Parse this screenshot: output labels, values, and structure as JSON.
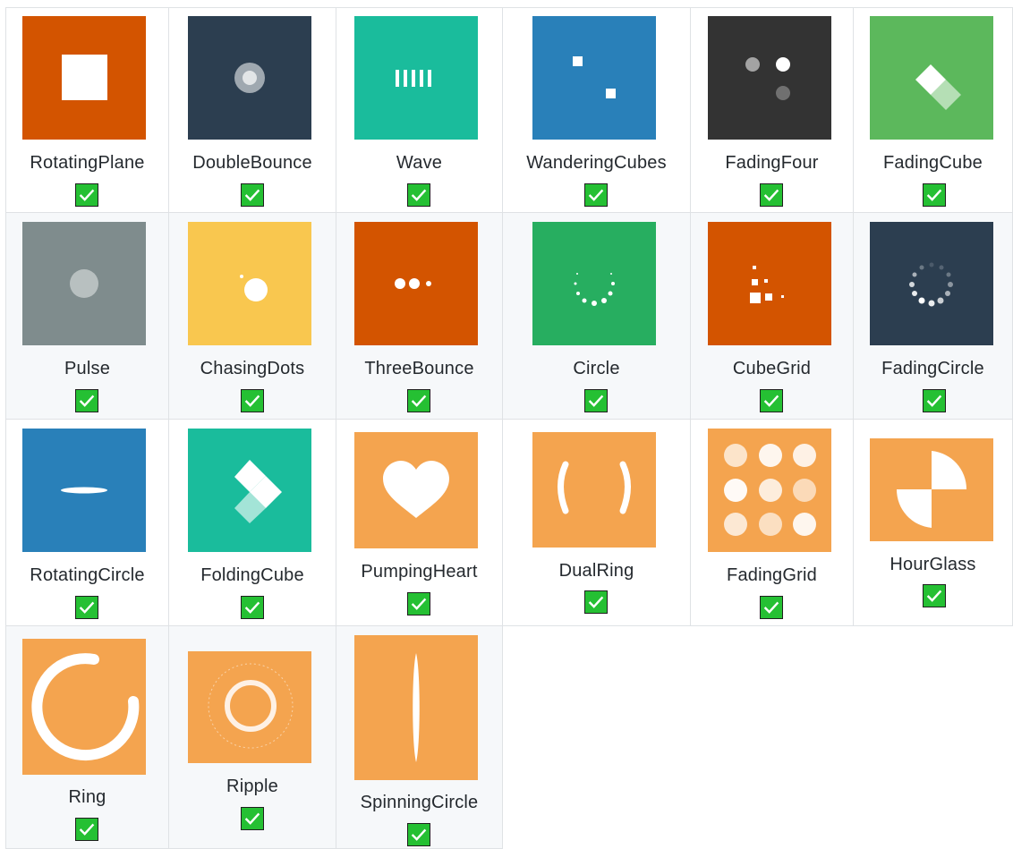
{
  "colors": {
    "orange_red": "#d35400",
    "navy": "#2c3e50",
    "teal": "#1abc9c",
    "blue": "#2980b9",
    "charcoal": "#333333",
    "green": "#5cb85c",
    "gray": "#7f8c8d",
    "yellow": "#f9c74f",
    "emerald": "#27ae60",
    "orange": "#f4a44f",
    "check_green": "#25c033"
  },
  "spinners": [
    {
      "label": "RotatingPlane",
      "icon": "rotating-plane-icon",
      "status": "checked"
    },
    {
      "label": "DoubleBounce",
      "icon": "double-bounce-icon",
      "status": "checked"
    },
    {
      "label": "Wave",
      "icon": "wave-icon",
      "status": "checked"
    },
    {
      "label": "WanderingCubes",
      "icon": "wandering-cubes-icon",
      "status": "checked"
    },
    {
      "label": "FadingFour",
      "icon": "fading-four-icon",
      "status": "checked"
    },
    {
      "label": "FadingCube",
      "icon": "fading-cube-icon",
      "status": "checked"
    },
    {
      "label": "Pulse",
      "icon": "pulse-icon",
      "status": "checked"
    },
    {
      "label": "ChasingDots",
      "icon": "chasing-dots-icon",
      "status": "checked"
    },
    {
      "label": "ThreeBounce",
      "icon": "three-bounce-icon",
      "status": "checked"
    },
    {
      "label": "Circle",
      "icon": "circle-icon",
      "status": "checked"
    },
    {
      "label": "CubeGrid",
      "icon": "cube-grid-icon",
      "status": "checked"
    },
    {
      "label": "FadingCircle",
      "icon": "fading-circle-icon",
      "status": "checked"
    },
    {
      "label": "RotatingCircle",
      "icon": "rotating-circle-icon",
      "status": "checked"
    },
    {
      "label": "FoldingCube",
      "icon": "folding-cube-icon",
      "status": "checked"
    },
    {
      "label": "PumpingHeart",
      "icon": "pumping-heart-icon",
      "status": "checked"
    },
    {
      "label": "DualRing",
      "icon": "dual-ring-icon",
      "status": "checked"
    },
    {
      "label": "FadingGrid",
      "icon": "fading-grid-icon",
      "status": "checked"
    },
    {
      "label": "HourGlass",
      "icon": "hour-glass-icon",
      "status": "checked"
    },
    {
      "label": "Ring",
      "icon": "ring-icon",
      "status": "checked"
    },
    {
      "label": "Ripple",
      "icon": "ripple-icon",
      "status": "checked"
    },
    {
      "label": "SpinningCircle",
      "icon": "spinning-circle-icon",
      "status": "checked"
    }
  ]
}
